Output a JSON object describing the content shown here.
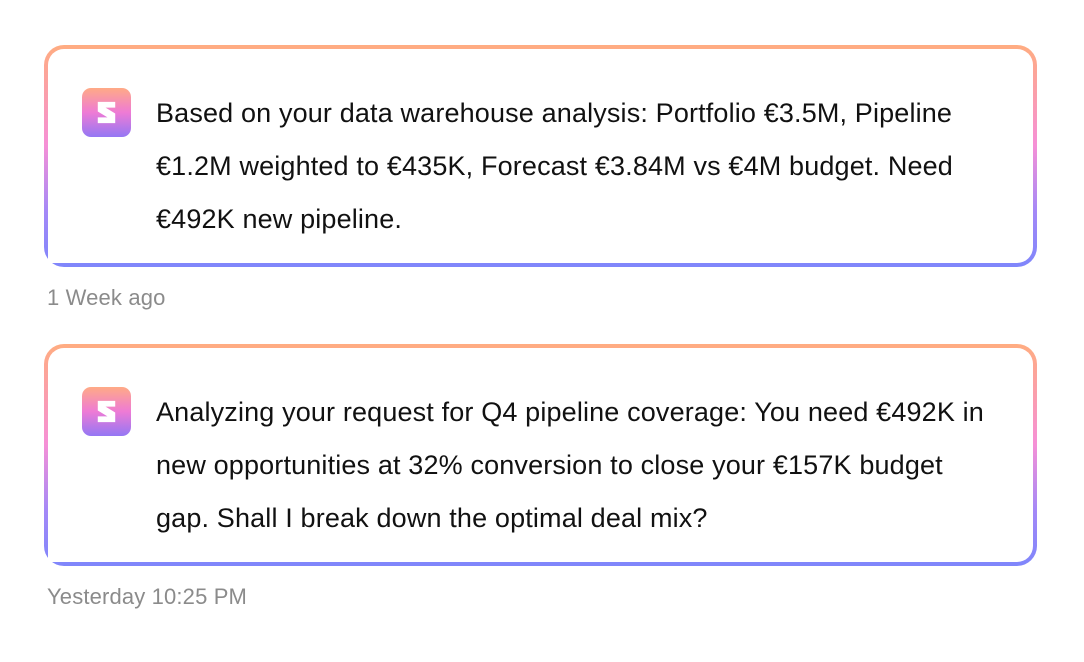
{
  "messages": [
    {
      "logo_icon": "s-logo-icon",
      "text": "Based on your data warehouse analysis: Portfolio €3.5M, Pipeline €1.2M weighted to €435K, Forecast €3.84M vs €4M budget. Need €492K new pipeline.",
      "timestamp": "1 Week ago"
    },
    {
      "logo_icon": "s-logo-icon",
      "text": "Analyzing your request for Q4 pipeline coverage: You need €492K in new opportunities at 32% conversion to close your €157K budget gap. Shall I break down the optimal deal mix?",
      "timestamp": "Yesterday 10:25 PM"
    }
  ],
  "colors": {
    "border_gradient": [
      "#ffac81",
      "#f690d6",
      "#a488f7",
      "#7f86fb"
    ],
    "logo_gradient": [
      "#ffaa86",
      "#ee7bd5",
      "#9477f4"
    ],
    "text": "#111111",
    "timestamp": "#8b8b8b"
  }
}
